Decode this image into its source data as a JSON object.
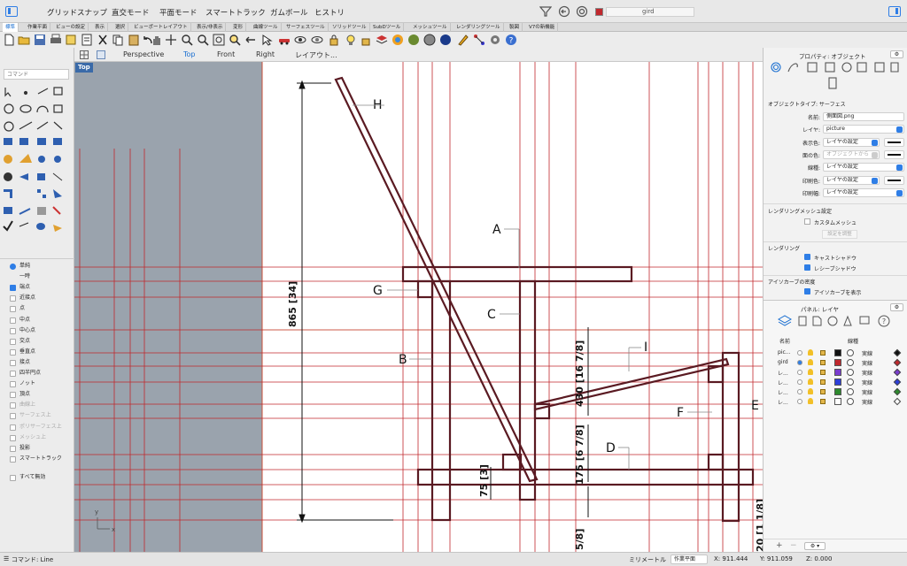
{
  "top_menu": {
    "items": [
      "グリッドスナップ",
      "直交モード",
      "平面モード",
      "スマートトラック",
      "ガムボール",
      "ヒストリ"
    ],
    "layer_name": "gird"
  },
  "ribbon_tabs": [
    "標準",
    "作業平面",
    "ビューの設定",
    "表示",
    "選択",
    "ビューポートレイアウト",
    "表示/非表示",
    "変形",
    "曲線ツール",
    "サーフェスツール",
    "ソリッドツール",
    "SubDツール",
    "メッシュツール",
    "レンダリングツール",
    "製図",
    "V7の新機能"
  ],
  "command": {
    "placeholder": "コマンド"
  },
  "osnap": {
    "items": [
      {
        "label": "単純",
        "type": "radio",
        "on": true,
        "dim": false
      },
      {
        "label": "一時",
        "type": "none",
        "on": false,
        "dim": false
      },
      {
        "label": "端点",
        "type": "check",
        "on": true,
        "dim": false
      },
      {
        "label": "近接点",
        "type": "check",
        "on": false,
        "dim": false
      },
      {
        "label": "点",
        "type": "check",
        "on": false,
        "dim": false
      },
      {
        "label": "中点",
        "type": "check",
        "on": false,
        "dim": false
      },
      {
        "label": "中心点",
        "type": "check",
        "on": false,
        "dim": false
      },
      {
        "label": "交点",
        "type": "check",
        "on": false,
        "dim": false
      },
      {
        "label": "垂直点",
        "type": "check",
        "on": false,
        "dim": false
      },
      {
        "label": "接点",
        "type": "check",
        "on": false,
        "dim": false
      },
      {
        "label": "四半円点",
        "type": "check",
        "on": false,
        "dim": false
      },
      {
        "label": "ノット",
        "type": "check",
        "on": false,
        "dim": false
      },
      {
        "label": "頂点",
        "type": "check",
        "on": false,
        "dim": false
      },
      {
        "label": "曲線上",
        "type": "check",
        "on": false,
        "dim": true
      },
      {
        "label": "サーフェス上",
        "type": "check",
        "on": false,
        "dim": true
      },
      {
        "label": "ポリサーフェス上",
        "type": "check",
        "on": false,
        "dim": true
      },
      {
        "label": "メッシュ上",
        "type": "check",
        "on": false,
        "dim": true
      },
      {
        "label": "投影",
        "type": "check",
        "on": false,
        "dim": false
      },
      {
        "label": "スマートトラック",
        "type": "check",
        "on": false,
        "dim": false
      }
    ],
    "disable_all": "すべて無効"
  },
  "viewport_tabs": [
    "Perspective",
    "Top",
    "Front",
    "Right",
    "レイアウト..."
  ],
  "viewport": {
    "name": "Top",
    "labels": [
      "H",
      "A",
      "G",
      "C",
      "B",
      "I",
      "E",
      "F",
      "D"
    ],
    "dims": [
      "865 [34]",
      "430 [16 7/8]",
      "175 [6 7/8]",
      "75 [3]",
      "5/8]",
      "20 [1 1/8]"
    ],
    "axis_x": "x",
    "axis_y": "y"
  },
  "properties": {
    "title": "プロパティ: オブジェクト",
    "object_type": "オブジェクトタイプ: サーフェス",
    "rows": [
      {
        "label": "名前:",
        "value": "側面図.png"
      },
      {
        "label": "レイヤ:",
        "value": "picture"
      },
      {
        "label": "表示色:",
        "value": "レイヤの設定"
      },
      {
        "label": "面の色:",
        "value": "オブジェクトから"
      },
      {
        "label": "線種:",
        "value": "レイヤの設定"
      },
      {
        "label": "印刷色:",
        "value": "レイヤの設定"
      },
      {
        "label": "印刷幅:",
        "value": "レイヤの設定"
      }
    ],
    "render_mesh": "レンダリングメッシュ設定",
    "custom_mesh": "カスタムメッシュ",
    "adjust": "設定を調整",
    "rendering": "レンダリング",
    "cast_shadow": "キャストシャドウ",
    "receive_shadow": "レシーブシャドウ",
    "isocurve_density": "アイソカーブの密度",
    "show_isocurves": "アイソカーブを表示"
  },
  "layers": {
    "title": "パネル: レイヤ",
    "col_name": "名前",
    "col_linetype": "線種",
    "rows": [
      {
        "name": "pic...",
        "color": "#111111",
        "linetype": "実線",
        "current": false
      },
      {
        "name": "gird",
        "color": "#c0282d",
        "linetype": "実線",
        "current": true
      },
      {
        "name": "レ...",
        "color": "#7a3ccf",
        "linetype": "実線",
        "current": false
      },
      {
        "name": "レ...",
        "color": "#2d3fd9",
        "linetype": "実線",
        "current": false
      },
      {
        "name": "レ...",
        "color": "#2e8a2e",
        "linetype": "実線",
        "current": false
      },
      {
        "name": "レ...",
        "color": "#ffffff",
        "linetype": "実線",
        "current": false
      }
    ]
  },
  "status": {
    "command": "コマンド: Line",
    "units": "ミリメートル",
    "cplane": "作業平面",
    "x": "X: 911.444",
    "y": "Y: 911.059",
    "z": "Z: 0.000"
  },
  "colors": {
    "accent": "#1a6fd1",
    "grid_red": "#c0282d",
    "drawing": "#5a1a22"
  }
}
